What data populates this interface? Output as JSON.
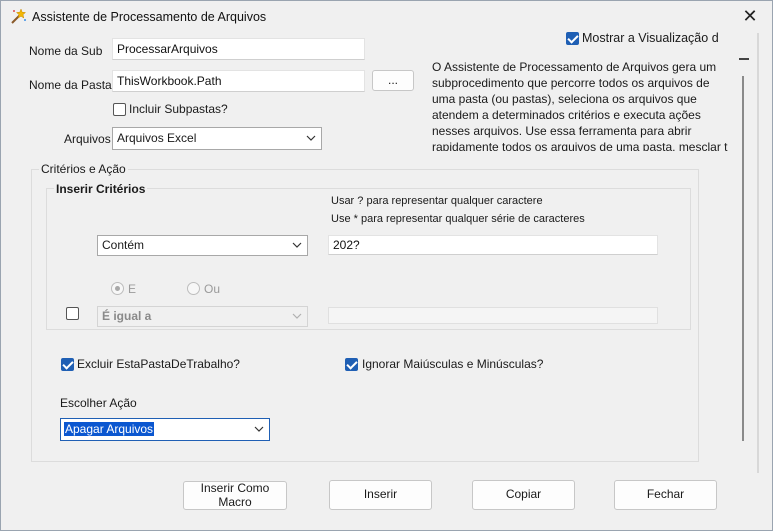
{
  "window": {
    "title": "Assistente de Processamento de Arquivos",
    "close_symbol": "✕"
  },
  "form": {
    "nome_sub_label": "Nome da Sub",
    "nome_sub_value": "ProcessarArquivos",
    "nome_pasta_label": "Nome da Pasta",
    "nome_pasta_value": "ThisWorkbook.Path",
    "browse_label": "...",
    "incluir_subpastas_label": "Incluir Subpastas?",
    "incluir_subpastas_checked": false,
    "arquivos_label": "Arquivos",
    "arquivos_value": "Arquivos Excel"
  },
  "preview": {
    "mostrar_label": "Mostrar  a  Visualização d",
    "mostrar_checked": true,
    "description": "O Assistente de Processamento de Arquivos gera um subprocedimento que percorre todos os arquivos de uma pasta (ou pastas), seleciona os arquivos que atendem a determinados critérios e executa ações nesses arquivos.        Use essa ferramenta para abrir rapidamente todos os arquivos de uma pasta, mesclar t"
  },
  "criteria": {
    "frame_label": "Critérios e Ação",
    "inner_label": "Inserir Critérios",
    "hint1": "Usar ? para representar qualquer caractere",
    "hint2": "Use * para representar qualquer série de caracteres",
    "op1_value": "Contém",
    "value1": "202?",
    "radio_e_label": "E",
    "radio_ou_label": "Ou",
    "radio_selected": "E",
    "op2_value": "É igual a",
    "value2": "",
    "row2_checked": false
  },
  "options": {
    "excluir_label": "Excluir EstaPastaDeTrabalho?",
    "excluir_checked": true,
    "ignorar_label": "Ignorar Maiúsculas e Minúsculas?",
    "ignorar_checked": true,
    "escolher_acao_label": "Escolher Ação",
    "acao_value": "Apagar Arquivos"
  },
  "buttons": {
    "inserir_macro": "Inserir Como Macro",
    "inserir": "Inserir",
    "copiar": "Copiar",
    "fechar": "Fechar"
  },
  "colors": {
    "accent": "#1f5fb4",
    "selection": "#0b57d0"
  }
}
